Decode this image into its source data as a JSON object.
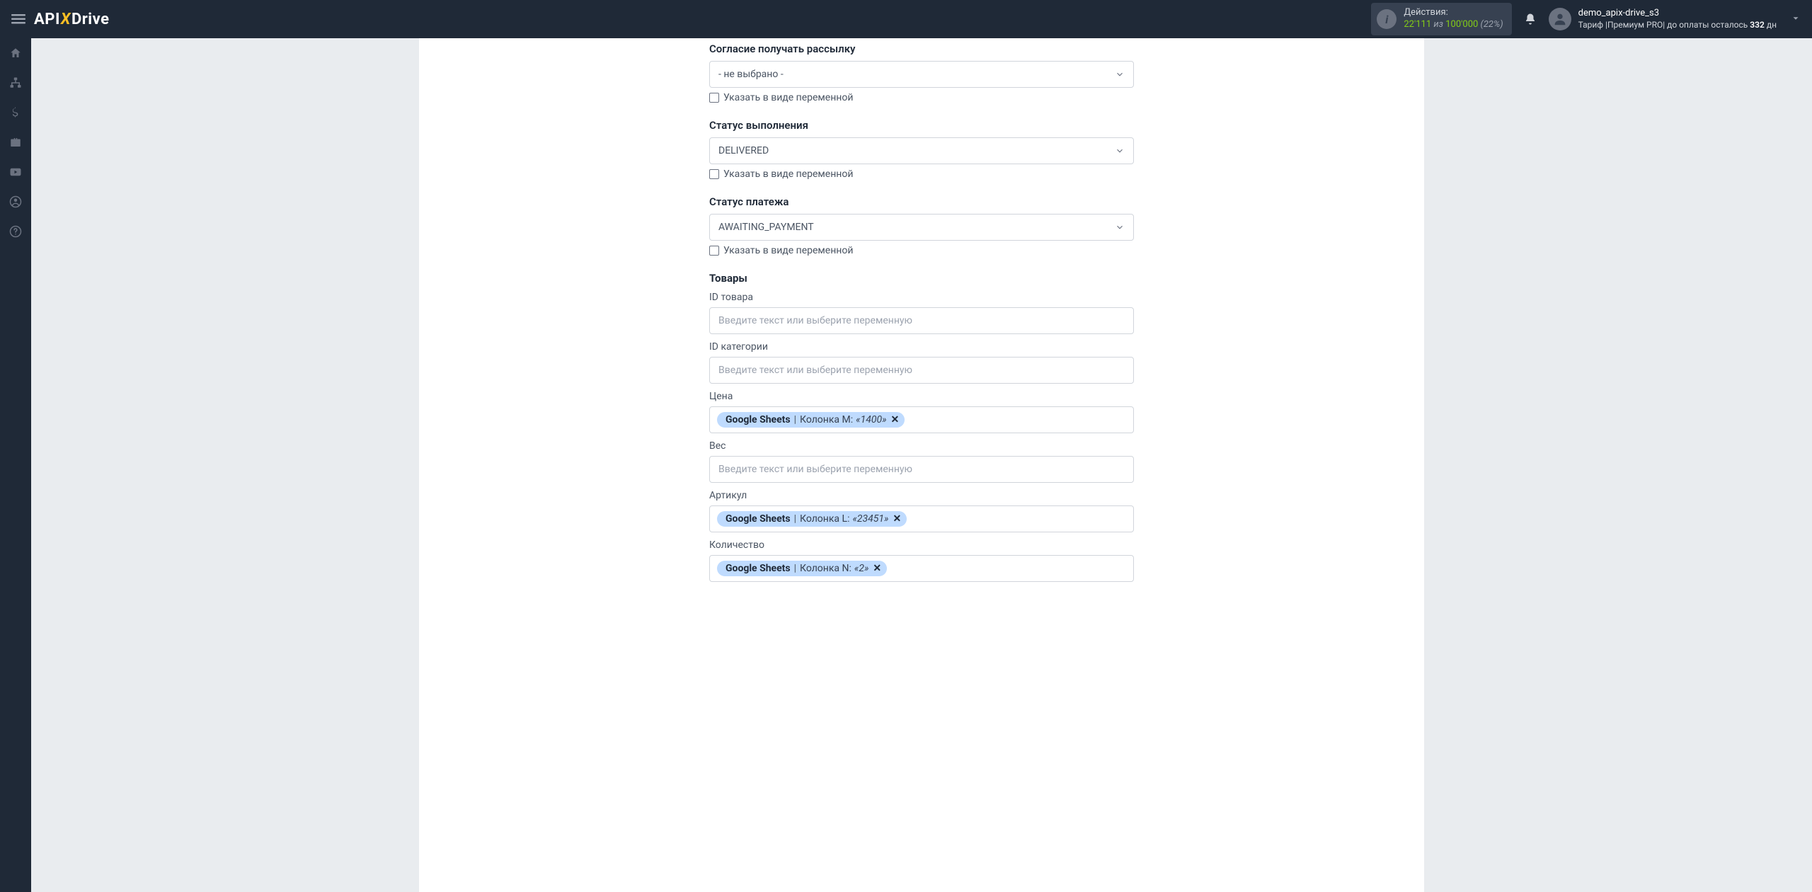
{
  "header": {
    "logo_api": "API",
    "logo_x": "X",
    "logo_drive": "Drive",
    "actions_label": "Действия:",
    "actions_current": "22'111",
    "actions_of": " из ",
    "actions_max": "100'000",
    "actions_pct": " (22%)",
    "user_name": "demo_apix-drive_s3",
    "tariff_label": "Тариф |",
    "tariff_name": "Премиум PRO",
    "tariff_sep": "|  до оплаты осталось ",
    "tariff_days": "332",
    "tariff_unit": " дн"
  },
  "sidebar": {
    "icons": [
      "home",
      "sitemap",
      "dollar",
      "briefcase",
      "youtube",
      "user",
      "help"
    ]
  },
  "form": {
    "f1": {
      "label": "Согласие получать рассылку",
      "value": "- не выбрано -",
      "checkbox": "Указать в виде переменной"
    },
    "f2": {
      "label": "Статус выполнения",
      "value": "DELIVERED",
      "checkbox": "Указать в виде переменной"
    },
    "f3": {
      "label": "Статус платежа",
      "value": "AWAITING_PAYMENT",
      "checkbox": "Указать в виде переменной"
    },
    "section": "Товары",
    "p1": {
      "label": "ID товара",
      "placeholder": "Введите текст или выберите переменную"
    },
    "p2": {
      "label": "ID категории",
      "placeholder": "Введите текст или выберите переменную"
    },
    "p3": {
      "label": "Цена",
      "tag_src": "Google Sheets",
      "tag_col": "Колонка M: ",
      "tag_val": "«1400»"
    },
    "p4": {
      "label": "Вес",
      "placeholder": "Введите текст или выберите переменную"
    },
    "p5": {
      "label": "Артикул",
      "tag_src": "Google Sheets",
      "tag_col": "Колонка L: ",
      "tag_val": "«23451»"
    },
    "p6": {
      "label": "Количество",
      "tag_src": "Google Sheets",
      "tag_col": "Колонка N: ",
      "tag_val": "«2»"
    }
  }
}
